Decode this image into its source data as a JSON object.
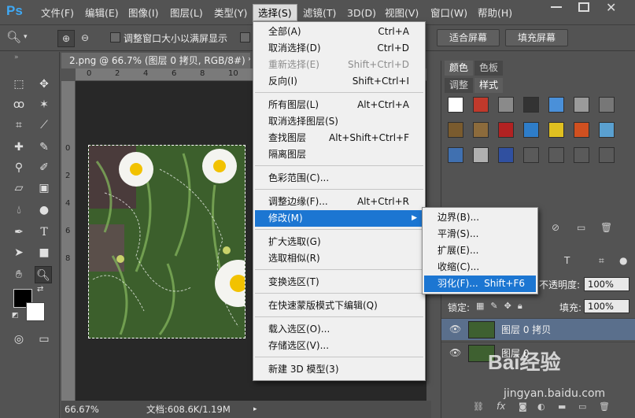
{
  "app": {
    "logo": "Ps"
  },
  "menubar": {
    "items": [
      "文件(F)",
      "编辑(E)",
      "图像(I)",
      "图层(L)",
      "类型(Y)",
      "选择(S)",
      "滤镜(T)",
      "3D(D)",
      "视图(V)",
      "窗口(W)",
      "帮助(H)"
    ],
    "active_index": 5
  },
  "options": {
    "resize_windows_label": "调整窗口大小以满屏显示",
    "fit_screen_label": "适合屏幕",
    "fill_screen_label": "填充屏幕"
  },
  "document": {
    "tab_title": "2.png @ 66.7% (图层 0 拷贝, RGB/8#) *",
    "ruler_h_ticks": [
      "0",
      "2",
      "4",
      "6",
      "8",
      "10",
      "12",
      "14"
    ],
    "ruler_v_ticks": [
      "0",
      "2",
      "4",
      "6",
      "8"
    ],
    "zoom": "66.67%",
    "doc_size": "文档:608.6K/1.19M"
  },
  "select_menu": {
    "items": [
      {
        "label": "全部(A)",
        "shortcut": "Ctrl+A",
        "disabled": false
      },
      {
        "label": "取消选择(D)",
        "shortcut": "Ctrl+D",
        "disabled": false
      },
      {
        "label": "重新选择(E)",
        "shortcut": "Shift+Ctrl+D",
        "disabled": true
      },
      {
        "label": "反向(I)",
        "shortcut": "Shift+Ctrl+I",
        "disabled": false
      },
      {
        "label": "所有图层(L)",
        "shortcut": "Alt+Ctrl+A",
        "disabled": false
      },
      {
        "label": "取消选择图层(S)",
        "shortcut": "",
        "disabled": false
      },
      {
        "label": "查找图层",
        "shortcut": "Alt+Shift+Ctrl+F",
        "disabled": false
      },
      {
        "label": "隔离图层",
        "shortcut": "",
        "disabled": false
      },
      {
        "label": "色彩范围(C)...",
        "shortcut": "",
        "disabled": false
      },
      {
        "label": "调整边缘(F)...",
        "shortcut": "Alt+Ctrl+R",
        "disabled": false
      },
      {
        "label": "修改(M)",
        "shortcut": "",
        "disabled": false,
        "submenu": true,
        "highlighted": true
      },
      {
        "label": "扩大选取(G)",
        "shortcut": "",
        "disabled": false
      },
      {
        "label": "选取相似(R)",
        "shortcut": "",
        "disabled": false
      },
      {
        "label": "变换选区(T)",
        "shortcut": "",
        "disabled": false
      },
      {
        "label": "在快速蒙版模式下编辑(Q)",
        "shortcut": "",
        "disabled": false
      },
      {
        "label": "载入选区(O)...",
        "shortcut": "",
        "disabled": false
      },
      {
        "label": "存储选区(V)...",
        "shortcut": "",
        "disabled": false
      },
      {
        "label": "新建 3D 模型(3)",
        "shortcut": "",
        "disabled": false
      }
    ]
  },
  "modify_submenu": {
    "items": [
      {
        "label": "边界(B)...",
        "shortcut": ""
      },
      {
        "label": "平滑(S)...",
        "shortcut": ""
      },
      {
        "label": "扩展(E)...",
        "shortcut": ""
      },
      {
        "label": "收缩(C)...",
        "shortcut": ""
      },
      {
        "label": "羽化(F)...",
        "shortcut": "Shift+F6",
        "highlighted": true
      }
    ]
  },
  "panels": {
    "top_tabs": [
      "颜色",
      "色板"
    ],
    "style_tabs": [
      "调整",
      "样式"
    ],
    "swatch_colors": [
      "#ffffff",
      "#c0392b",
      "#8a8a8a",
      "#333333",
      "#4a90d9",
      "#9a9a9a",
      "#777777",
      "#7a5b2e",
      "#8c6b3c",
      "#b22222",
      "#2e7dc9",
      "#e0c020",
      "#d05020",
      "#5aa0d0",
      "#4070b0",
      "#b0b0b0",
      "#3050a0",
      "#5a5a5a",
      "#5a5a5a",
      "#5a5a5a",
      "#5a5a5a"
    ]
  },
  "layers": {
    "opacity_label": "不透明度:",
    "opacity_value": "100%",
    "lock_label": "锁定:",
    "fill_label": "填充:",
    "fill_value": "100%",
    "rows": [
      {
        "name": "图层 0 拷贝",
        "selected": true
      },
      {
        "name": "图层 0",
        "selected": false
      }
    ]
  },
  "watermark": {
    "brand": "Bai经验",
    "url": "jingyan.baidu.com"
  }
}
